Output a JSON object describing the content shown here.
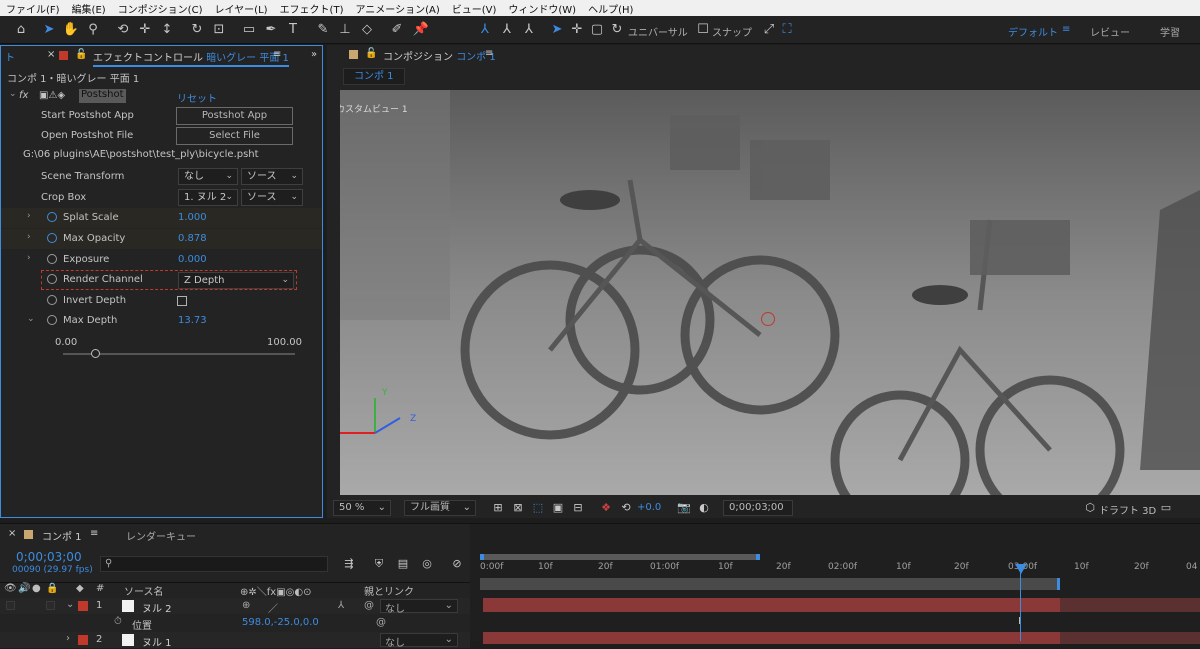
{
  "menu": [
    "ファイル(F)",
    "編集(E)",
    "コンポジション(C)",
    "レイヤー(L)",
    "エフェクト(T)",
    "アニメーション(A)",
    "ビュー(V)",
    "ウィンドウ(W)",
    "ヘルプ(H)"
  ],
  "toolbar": {
    "universal": "ユニバーサル",
    "snap": "スナップ",
    "workspaces": [
      "デフォルト",
      "≡",
      "レビュー",
      "学習"
    ]
  },
  "effect_panel": {
    "tab_prefix": "エフェクトコントロール",
    "tab_layer": "暗いグレー 平面 1",
    "breadcrumb": "コンポ 1・暗いグレー 平面 1",
    "fx_label": "fx",
    "effect_name": "Postshot",
    "reset": "リセット",
    "start_app_label": "Start Postshot App",
    "start_app_button": "Postshot App",
    "open_file_label": "Open Postshot File",
    "open_file_button": "Select File",
    "file_path": "G:\\06 plugins\\AE\\postshot\\test_ply\\bicycle.psht",
    "scene_transform_label": "Scene Transform",
    "scene_transform_value": "なし",
    "scene_transform_source": "ソース",
    "crop_box_label": "Crop Box",
    "crop_box_value": "1. ヌル 2",
    "crop_box_source": "ソース",
    "splat_scale_label": "Splat Scale",
    "splat_scale_value": "1.000",
    "max_opacity_label": "Max Opacity",
    "max_opacity_value": "0.878",
    "exposure_label": "Exposure",
    "exposure_value": "0.000",
    "render_channel_label": "Render Channel",
    "render_channel_value": "Z Depth",
    "invert_depth_label": "Invert Depth",
    "max_depth_label": "Max Depth",
    "max_depth_value": "13.73",
    "slider_min": "0.00",
    "slider_max": "100.00",
    "slider_fraction": 0.137
  },
  "comp_panel": {
    "tab_prefix": "コンポジション",
    "tab_name": "コンポ 1",
    "sub_tab": "コンポ 1",
    "view_label": "カスタムビュー 1",
    "axis_x": "X",
    "axis_y": "Y",
    "axis_z": "Z",
    "zoom": "50 %",
    "quality": "フル画質",
    "exposure": "+0.0",
    "timecode": "0;00;03;00",
    "draft": "ドラフト 3D"
  },
  "timeline": {
    "tab_name": "コンポ 1",
    "render_queue": "レンダーキュー",
    "timecode": "0;00;03;00",
    "frame_info": "00090 (29.97 fps)",
    "search_placeholder": "",
    "source_name_header": "ソース名",
    "parent_header": "親とリンク",
    "ruler": [
      "0:00f",
      "10f",
      "20f",
      "01:00f",
      "10f",
      "20f",
      "02:00f",
      "10f",
      "20f",
      "03:00f",
      "10f",
      "20f",
      "04"
    ],
    "layers": [
      {
        "num": "1",
        "name": "ヌル 2",
        "parent": "なし"
      },
      {
        "num": "2",
        "name": "ヌル 1",
        "parent": "なし"
      }
    ],
    "position_label": "位置",
    "position_value": "598.0,-25.0,0.0"
  },
  "colors": {
    "accent": "#3d8ce0",
    "label_red": "#c0392b",
    "layer_bar": "#8a3838"
  }
}
